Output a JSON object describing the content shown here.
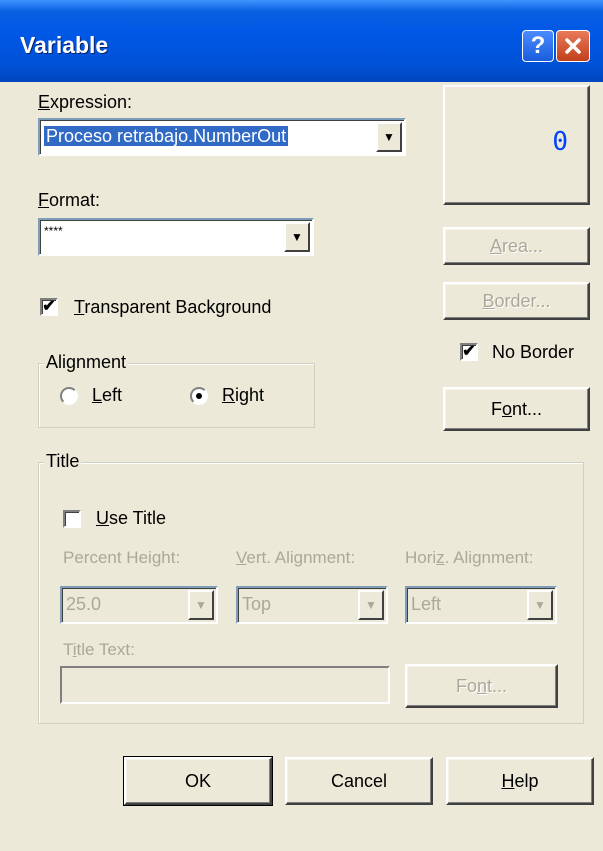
{
  "window": {
    "title": "Variable",
    "help_icon": "question-mark-icon",
    "close_icon": "close-x-icon"
  },
  "expression": {
    "label_accel": "E",
    "label_rest": "xpression:",
    "value": "Proceso retrabajo.NumberOut"
  },
  "format": {
    "label_accel": "F",
    "label_rest": "ormat:",
    "value": "****"
  },
  "preview": {
    "value": "0",
    "color": "#0040FF"
  },
  "transparent_background": {
    "checked": true,
    "label_accel": "T",
    "label_rest": "ransparent Background"
  },
  "alignment": {
    "group_label": "Alignment",
    "left_accel": "L",
    "left_rest": "eft",
    "right_accel": "R",
    "right_rest": "ight",
    "selected": "right"
  },
  "buttons": {
    "area_accel": "A",
    "area_rest": "rea...",
    "border_accel": "B",
    "border_rest": "order...",
    "font_pre": "F",
    "font_accel": "o",
    "font_rest": "nt...",
    "ok": "OK",
    "cancel": "Cancel",
    "help_accel": "H",
    "help_rest": "elp"
  },
  "no_border": {
    "checked": true,
    "label": "No Border"
  },
  "title_group": {
    "group_label": "Title",
    "use_title": {
      "checked": false,
      "label_accel": "U",
      "label_rest": "se Title"
    },
    "percent_height_label": "Percent Height:",
    "percent_height_value": "25.0",
    "vert_label_accel": "V",
    "vert_label_rest": "ert. Alignment:",
    "vert_value": "Top",
    "horiz_label_pre": "Hori",
    "horiz_label_accel": "z",
    "horiz_label_rest": ". Alignment:",
    "horiz_value": "Left",
    "title_text_label_pre": "T",
    "title_text_label_accel": "i",
    "title_text_label_rest": "tle Text:",
    "title_text_value": "",
    "font_pre": "Fo",
    "font_accel": "n",
    "font_rest": "t..."
  }
}
